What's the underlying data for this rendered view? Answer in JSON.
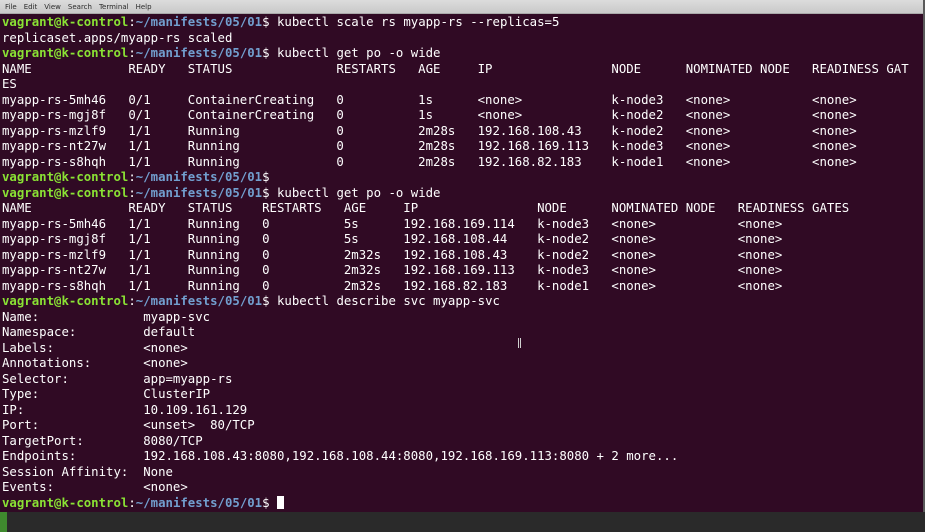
{
  "menubar": {
    "items": [
      "File",
      "Edit",
      "View",
      "Search",
      "Terminal",
      "Help"
    ]
  },
  "prompt": {
    "user": "vagrant@k-control",
    "path": "~/manifests/05/01",
    "symbol": "$"
  },
  "terminal": {
    "lines": [
      {
        "type": "prompt",
        "cmd": " kubectl scale rs myapp-rs --replicas=5"
      },
      {
        "type": "out",
        "text": "replicaset.apps/myapp-rs scaled"
      },
      {
        "type": "prompt",
        "cmd": " kubectl get po -o wide"
      },
      {
        "type": "out",
        "text": "NAME             READY   STATUS              RESTARTS   AGE     IP                NODE      NOMINATED NODE   READINESS GAT"
      },
      {
        "type": "out",
        "text": "ES"
      },
      {
        "type": "out",
        "text": "myapp-rs-5mh46   0/1     ContainerCreating   0          1s      <none>            k-node3   <none>           <none>"
      },
      {
        "type": "out",
        "text": "myapp-rs-mgj8f   0/1     ContainerCreating   0          1s      <none>            k-node2   <none>           <none>"
      },
      {
        "type": "out",
        "text": "myapp-rs-mzlf9   1/1     Running             0          2m28s   192.168.108.43    k-node2   <none>           <none>"
      },
      {
        "type": "out",
        "text": "myapp-rs-nt27w   1/1     Running             0          2m28s   192.168.169.113   k-node3   <none>           <none>"
      },
      {
        "type": "out",
        "text": "myapp-rs-s8hqh   1/1     Running             0          2m28s   192.168.82.183    k-node1   <none>           <none>"
      },
      {
        "type": "prompt",
        "cmd": ""
      },
      {
        "type": "prompt",
        "cmd": " kubectl get po -o wide"
      },
      {
        "type": "out",
        "text": "NAME             READY   STATUS    RESTARTS   AGE     IP                NODE      NOMINATED NODE   READINESS GATES"
      },
      {
        "type": "out",
        "text": "myapp-rs-5mh46   1/1     Running   0          5s      192.168.169.114   k-node3   <none>           <none>"
      },
      {
        "type": "out",
        "text": "myapp-rs-mgj8f   1/1     Running   0          5s      192.168.108.44    k-node2   <none>           <none>"
      },
      {
        "type": "out",
        "text": "myapp-rs-mzlf9   1/1     Running   0          2m32s   192.168.108.43    k-node2   <none>           <none>"
      },
      {
        "type": "out",
        "text": "myapp-rs-nt27w   1/1     Running   0          2m32s   192.168.169.113   k-node3   <none>           <none>"
      },
      {
        "type": "out",
        "text": "myapp-rs-s8hqh   1/1     Running   0          2m32s   192.168.82.183    k-node1   <none>           <none>"
      },
      {
        "type": "prompt",
        "cmd": " kubectl describe svc myapp-svc"
      },
      {
        "type": "out",
        "text": "Name:              myapp-svc"
      },
      {
        "type": "out",
        "text": "Namespace:         default"
      },
      {
        "type": "out",
        "text": "Labels:            <none>"
      },
      {
        "type": "out",
        "text": "Annotations:       <none>"
      },
      {
        "type": "out",
        "text": "Selector:          app=myapp-rs"
      },
      {
        "type": "out",
        "text": "Type:              ClusterIP"
      },
      {
        "type": "out",
        "text": "IP:                10.109.161.129"
      },
      {
        "type": "out",
        "text": "Port:              <unset>  80/TCP"
      },
      {
        "type": "out",
        "text": "TargetPort:        8080/TCP"
      },
      {
        "type": "out",
        "text": "Endpoints:         192.168.108.43:8080,192.168.108.44:8080,192.168.169.113:8080 + 2 more..."
      },
      {
        "type": "out",
        "text": "Session Affinity:  None"
      },
      {
        "type": "out",
        "text": "Events:            <none>"
      },
      {
        "type": "prompt",
        "cmd": "",
        "cursor": true
      }
    ]
  },
  "colors": {
    "background": "#300a24",
    "prompt_user": "#8ae234",
    "prompt_path": "#729fcf",
    "text": "#ffffff"
  }
}
